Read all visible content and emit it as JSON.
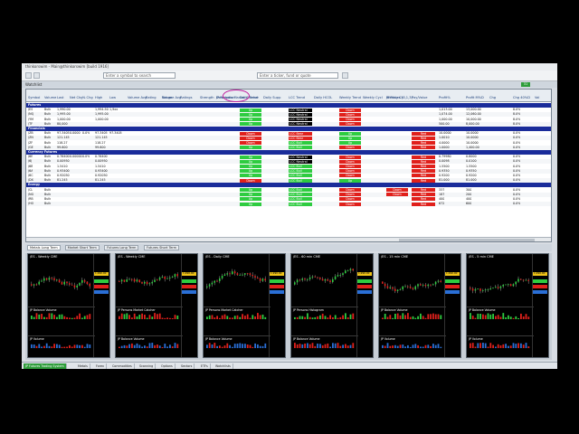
{
  "window": {
    "title": "thinkorswim - Main@thinkorswim [build 1916]"
  },
  "toolbar": {
    "symbol_placeholder": "Enter a symbol to search",
    "search_placeholder": "Enter a ticker, fund or quote"
  },
  "watchlist": {
    "title": "Watchlist",
    "badge": "31"
  },
  "grid": {
    "group_headers": [
      "Volume Avg",
      "JP Persons Market Catcher",
      "JP Places (3,1,3)"
    ],
    "columns": [
      "Symbol",
      "Volume",
      "Last",
      "Net Chg",
      "% Chg",
      "High",
      "Low",
      "Volume Avg",
      "Rating",
      "Range",
      "Ratings",
      "Strength",
      "Description",
      "Daily Trend",
      "Daily Supp",
      "LCC Trend",
      "Daily HCOL",
      "Weekly Trend",
      "Weekly Cycl",
      "Weekly Ch",
      "Pay/Value",
      "Profit%",
      "Profit M%D",
      "Chg",
      "Chg 40%D",
      "Vol"
    ],
    "sections": [
      {
        "name": "Futures",
        "rows": [
          {
            "sym": "/ES",
            "vol": "Bulk",
            "last": "1,990.00",
            "chg": "",
            "pct": "",
            "high": "1,994.50",
            "low": "1,9xx",
            "trend": "Up",
            "lcc": "LCC Neutral",
            "wk": "Down",
            "wkc": "",
            "pv": "",
            "p1": "1,013.00",
            "p2": "13,000.00",
            "p3": "8.0%"
          },
          {
            "sym": "/NQ",
            "vol": "Bulk",
            "last": "1,995.00",
            "chg": "",
            "pct": "",
            "high": "1,995.00",
            "low": "",
            "trend": "Up",
            "lcc": "LCC Neutral",
            "wk": "Down",
            "wkc": "",
            "pv": "",
            "p1": "1,074.00",
            "p2": "12,060.00",
            "p3": "8.0%"
          },
          {
            "sym": "/YM",
            "vol": "Bulk",
            "last": "1,000.00",
            "chg": "",
            "pct": "",
            "high": "1,000.00",
            "low": "",
            "trend": "Up",
            "lcc": "LCC Neutral",
            "wk": "Down",
            "wkc": "",
            "pv": "",
            "p1": "1,000.00",
            "p2": "10,000.00",
            "p3": "8.0%"
          },
          {
            "sym": "/TF",
            "vol": "Bulk",
            "last": "80,000",
            "chg": "",
            "pct": "",
            "high": "",
            "low": "",
            "trend": "Up",
            "lcc": "LCC Neutral",
            "wk": "Down",
            "wkc": "",
            "pv": "",
            "p1": "500.00",
            "p2": "8,000.00",
            "p3": "8.0%"
          }
        ]
      },
      {
        "name": "Financials",
        "rows": [
          {
            "sym": "/ZB",
            "vol": "Bulk",
            "last": "97.3405",
            "chg": "0.0000",
            "pct": "0.0%",
            "high": "97.3405",
            "low": "97.3405",
            "trend": "Down",
            "lcc": "LCC Bear",
            "wk": "Up",
            "wkc": "",
            "pv": "Red",
            "p1": "10.0000",
            "p2": "10.0000",
            "p3": "0.0%"
          },
          {
            "sym": "/ZN",
            "vol": "Bulk",
            "last": "121.145",
            "chg": "",
            "pct": "",
            "high": "121.145",
            "low": "",
            "trend": "Down",
            "lcc": "LCC Bear",
            "wk": "Up",
            "wkc": "",
            "pv": "Red",
            "p1": "1.0010",
            "p2": "10.0000",
            "p3": "0.0%"
          },
          {
            "sym": "/ZF",
            "vol": "Bulk",
            "last": "118.27",
            "chg": "",
            "pct": "",
            "high": "118.27",
            "low": "",
            "trend": "Down",
            "lcc": "LCC Bull",
            "wk": "Up",
            "wkc": "",
            "pv": "Red",
            "p1": "4.0000",
            "p2": "10.0000",
            "p3": "0.0%"
          },
          {
            "sym": "/GE",
            "vol": "Bulk",
            "last": "99.600",
            "chg": "",
            "pct": "",
            "high": "99.600",
            "low": "",
            "trend": "Up",
            "lcc": "LCC Bull",
            "wk": "Down",
            "wkc": "",
            "pv": "Red",
            "p1": "1.0000",
            "p2": "1,400.00",
            "p3": "0.0%"
          }
        ]
      },
      {
        "name": "Currency Futures",
        "rows": [
          {
            "sym": "/6E",
            "vol": "Bulk",
            "last": "0.76400",
            "chg": "0.00000",
            "pct": "0.0%",
            "high": "0.76400",
            "low": "",
            "trend": "Up",
            "lcc": "LCC Neutral",
            "wk": "Down",
            "wkc": "",
            "pv": "Red",
            "p1": "0.79980",
            "p2": "0.8000",
            "p3": "0.0%"
          },
          {
            "sym": "/6J",
            "vol": "Bulk",
            "last": "0.00950",
            "chg": "",
            "pct": "",
            "high": "0.00950",
            "low": "",
            "trend": "Up",
            "lcc": "LCC Neutral",
            "wk": "Down",
            "wkc": "",
            "pv": "Red",
            "p1": "0.0098",
            "p2": "0.0100",
            "p3": "0.0%"
          },
          {
            "sym": "/6B",
            "vol": "Bulk",
            "last": "1.5410",
            "chg": "",
            "pct": "",
            "high": "1.5410",
            "low": "",
            "trend": "Up",
            "lcc": "LCC Bull",
            "wk": "Down",
            "wkc": "",
            "pv": "Red",
            "p1": "1.5500",
            "p2": "1.5500",
            "p3": "0.0%"
          },
          {
            "sym": "/6A",
            "vol": "Bulk",
            "last": "0.93400",
            "chg": "",
            "pct": "",
            "high": "0.93400",
            "low": "",
            "trend": "Up",
            "lcc": "LCC Bull",
            "wk": "Down",
            "wkc": "",
            "pv": "Red",
            "p1": "0.9350",
            "p2": "0.9350",
            "p3": "0.0%"
          },
          {
            "sym": "/6C",
            "vol": "Bulk",
            "last": "0.92050",
            "chg": "",
            "pct": "",
            "high": "0.92050",
            "low": "",
            "trend": "Up",
            "lcc": "LCC Bull",
            "wk": "Down",
            "wkc": "",
            "pv": "Red",
            "p1": "0.9200",
            "p2": "0.9200",
            "p3": "0.0%"
          },
          {
            "sym": "/DX",
            "vol": "Bulk",
            "last": "81.245",
            "chg": "",
            "pct": "",
            "high": "81.245",
            "low": "",
            "trend": "Down",
            "lcc": "LCC Bull",
            "wk": "Up",
            "wkc": "",
            "pv": "Red",
            "p1": "81.000",
            "p2": "81.000",
            "p3": "0.0%"
          }
        ]
      },
      {
        "name": "Energy",
        "rows": [
          {
            "sym": "/CL",
            "vol": "Bulk",
            "last": "",
            "chg": "",
            "pct": "",
            "high": "",
            "low": "",
            "trend": "Up",
            "lcc": "LCC Bull",
            "wk": "Down",
            "wkc": "Down",
            "pv": "Red",
            "p1": "337",
            "p2": "300",
            "p3": "0.0%"
          },
          {
            "sym": "/NG",
            "vol": "Bulk",
            "last": "",
            "chg": "",
            "pct": "",
            "high": "",
            "low": "",
            "trend": "Up",
            "lcc": "LCC Bull",
            "wk": "Down",
            "wkc": "Down",
            "pv": "Red",
            "p1": "187",
            "p2": "200",
            "p3": "0.0%"
          },
          {
            "sym": "/RB",
            "vol": "Bulk",
            "last": "",
            "chg": "",
            "pct": "",
            "high": "",
            "low": "",
            "trend": "Up",
            "lcc": "LCC Bull",
            "wk": "Down",
            "wkc": "",
            "pv": "Red",
            "p1": "400",
            "p2": "400",
            "p3": "0.0%"
          },
          {
            "sym": "/HO",
            "vol": "Bulk",
            "last": "",
            "chg": "",
            "pct": "",
            "high": "",
            "low": "",
            "trend": "Up",
            "lcc": "LCC Bull",
            "wk": "Down",
            "wkc": "",
            "pv": "Red",
            "p1": "672",
            "p2": "600",
            "p3": "0.0%"
          }
        ]
      }
    ]
  },
  "tabs": [
    "Metals Long Term",
    "Market Short Term",
    "Futures Long Term",
    "Futures Short Term"
  ],
  "charts": [
    {
      "title": "/ES - Weekly CME",
      "price": "1,990.00",
      "ind1": "JP Balance Volume",
      "ind2": "JP Volume"
    },
    {
      "title": "/ES - Weekly CME",
      "price": "1,990.00",
      "ind1": "JP Persons Market Catcher",
      "ind2": "JP Balance Volume"
    },
    {
      "title": "/ES - Daily CME",
      "price": "1,990.00",
      "ind1": "JP Persons Market Catcher",
      "ind2": "JP Balance Volume"
    },
    {
      "title": "/ES - 60 min CME",
      "price": "1,990.00",
      "ind1": "JP Persons Histogram",
      "ind2": "JP Balance Volume"
    },
    {
      "title": "/ES - 15 min CME",
      "price": "1,990.00",
      "ind1": "JP Balance Volume",
      "ind2": "JP Volume"
    },
    {
      "title": "/ES - 5 min CME",
      "price": "1,990.00",
      "ind1": "JP Balance Volume",
      "ind2": "JP Volume"
    }
  ],
  "bottom_tabs": [
    "JP Futures Trading System",
    "Metals",
    "Forex",
    "Commodities",
    "Scanning",
    "Options",
    "Sectors",
    "ETFs",
    "Watchlists"
  ],
  "colors": {
    "section": "#1a2c9a",
    "up": "#2ecc40",
    "down": "#e0201b",
    "neutral": "#000000"
  }
}
